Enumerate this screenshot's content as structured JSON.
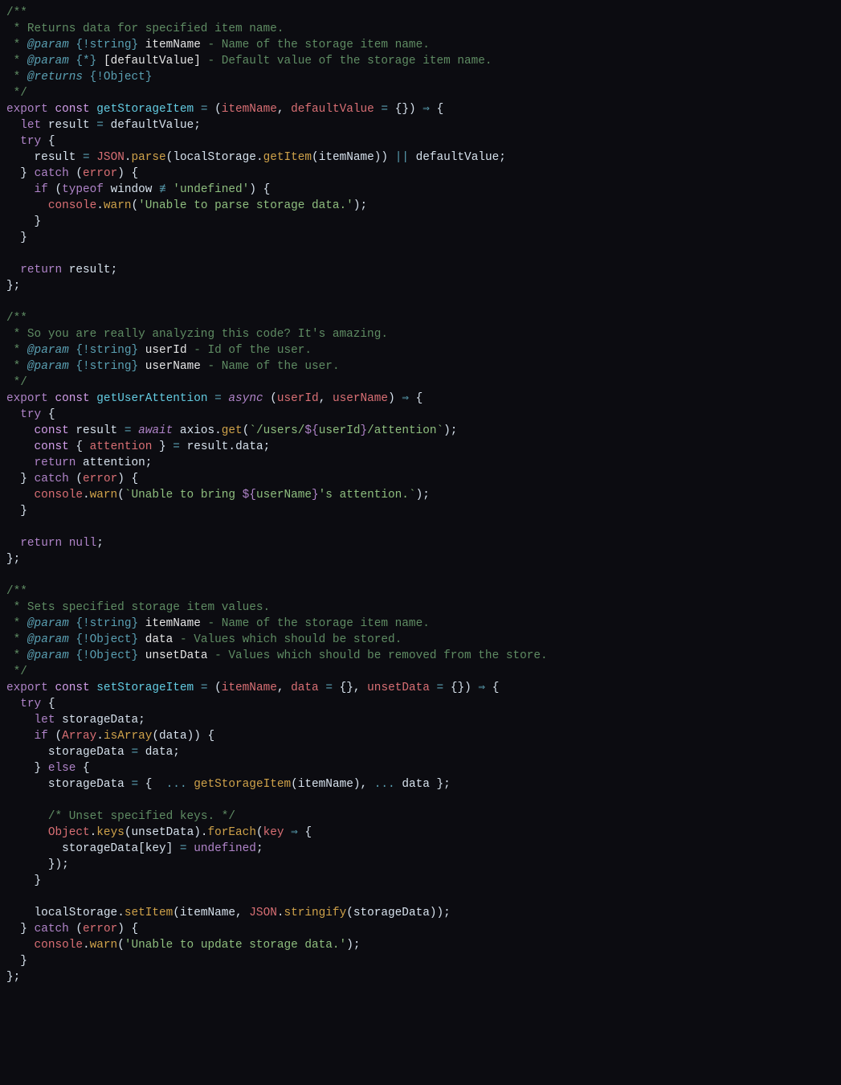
{
  "doc1": {
    "open": "/**",
    "l1": " * Returns data for specified item name.",
    "l2a": " * ",
    "l2tag": "@param",
    "l2sp": " ",
    "l2typ": "{!string}",
    "l2sp2": " ",
    "l2var": "itemName",
    "l2rest": " - Name of the storage item name.",
    "l3a": " * ",
    "l3tag": "@param",
    "l3sp": " ",
    "l3typ": "{*}",
    "l3sp2": " ",
    "l3var": "[defaultValue]",
    "l3rest": " - Default value of the storage item name.",
    "l4a": " * ",
    "l4tag": "@returns",
    "l4sp": " ",
    "l4typ": "{!Object}",
    "close": " */"
  },
  "f1": {
    "export": "export",
    "const": "const",
    "name": "getStorageItem",
    "eq": " = ",
    "args_open": "(",
    "arg1": "itemName",
    "comma": ", ",
    "arg2": "defaultValue",
    "def_eq": " = ",
    "def": "{}",
    "args_close": ")",
    "arrow": " ⇒ ",
    "brace": "{",
    "let": "let",
    "res": "result",
    "eq2": " = ",
    "dval": "defaultValue",
    "semi": ";",
    "try": "try",
    "try_open": " {",
    "res2": "result",
    "eq3": " = ",
    "json": "JSON",
    "dot": ".",
    "parse": "parse",
    "p1": "(",
    "ls": "localStorage",
    "dot2": ".",
    "get": "getItem",
    "p2": "(",
    "itm": "itemName",
    "p3": "))",
    "or": " || ",
    "dval2": "defaultValue",
    "semi2": ";",
    "catch": "} catch",
    "err_open": " (",
    "err": "error",
    "err_close": ") {",
    "if": "if",
    "if_open": " (",
    "typeof": "typeof",
    "win": " window ",
    "neq": "≢",
    "undef": " 'undefined'",
    "if_close": ") {",
    "cons": "console",
    "dot3": ".",
    "warn": "warn",
    "wmsg_open": "(",
    "wmsg": "'Unable to parse storage data.'",
    "wmsg_close": ");",
    "close_if": "}",
    "close_catch": "}",
    "return": "return",
    "retval": " result",
    "semi3": ";",
    "close_fn": "};"
  },
  "doc2": {
    "open": "/**",
    "l1": " * So you are really analyzing this code? It's amazing.",
    "l2a": " * ",
    "l2tag": "@param",
    "l2sp": " ",
    "l2typ": "{!string}",
    "l2sp2": " ",
    "l2var": "userId",
    "l2rest": " - Id of the user.",
    "l3a": " * ",
    "l3tag": "@param",
    "l3sp": " ",
    "l3typ": "{!string}",
    "l3sp2": " ",
    "l3var": "userName",
    "l3rest": " - Name of the user.",
    "close": " */"
  },
  "f2": {
    "export": "export",
    "const": "const",
    "name": "getUserAttention",
    "eq": " = ",
    "async": "async",
    "args_open": " (",
    "arg1": "userId",
    "comma": ", ",
    "arg2": "userName",
    "args_close": ")",
    "arrow": " ⇒ ",
    "brace": "{",
    "try": "try",
    "try_open": " {",
    "const2": "const",
    "res": " result",
    "eq2": " = ",
    "await": "await",
    "axios": " axios",
    "dot": ".",
    "get": "get",
    "p1": "(",
    "tpl_open": "`",
    "tpl1": "/users/",
    "exp_open": "${",
    "exp_var": "userId",
    "exp_close": "}",
    "tpl2": "/attention",
    "tpl_close": "`",
    "p2": ");",
    "const3": "const",
    "destr_open": " { ",
    "att": "attention",
    "destr_close": " }",
    "eq3": " = ",
    "resd": "result",
    "dot2": ".",
    "data": "data",
    "semi": ";",
    "return1": "return",
    "att2": " attention",
    "semi2": ";",
    "catch": "} catch",
    "err_open": " (",
    "err": "error",
    "err_close": ") {",
    "cons": "console",
    "dot3": ".",
    "warn": "warn",
    "w_open": "(",
    "t_open": "`",
    "t1": "Unable to bring ",
    "e_open": "${",
    "e_var": "userName",
    "e_close": "}",
    "t2": "'s attention.",
    "t_close": "`",
    "w_close": ");",
    "close_catch": "}",
    "return2": "return",
    "null": " null",
    "semi3": ";",
    "close_fn": "};"
  },
  "doc3": {
    "open": "/**",
    "l1": " * Sets specified storage item values.",
    "l2a": " * ",
    "l2tag": "@param",
    "l2sp": " ",
    "l2typ": "{!string}",
    "l2sp2": " ",
    "l2var": "itemName",
    "l2rest": " - Name of the storage item name.",
    "l3a": " * ",
    "l3tag": "@param",
    "l3sp": " ",
    "l3typ": "{!Object}",
    "l3sp2": " ",
    "l3var": "data",
    "l3rest": " - Values which should be stored.",
    "l4a": " * ",
    "l4tag": "@param",
    "l4sp": " ",
    "l4typ": "{!Object}",
    "l4sp2": " ",
    "l4var": "unsetData",
    "l4rest": " - Values which should be removed from the store.",
    "close": " */"
  },
  "f3": {
    "export": "export",
    "const": "const",
    "name": "setStorageItem",
    "eq": " = ",
    "args_open": "(",
    "arg1": "itemName",
    "c1": ", ",
    "arg2": "data",
    "d1": " = ",
    "d1v": "{}",
    "c2": ", ",
    "arg3": "unsetData",
    "d2": " = ",
    "d2v": "{}",
    "args_close": ")",
    "arrow": " ⇒ ",
    "brace": "{",
    "try": "try",
    "try_open": " {",
    "let": "let",
    "sd": " storageData",
    "semi0": ";",
    "if": "if",
    "if_open": " (",
    "Array": "Array",
    "dotA": ".",
    "isArray": "isArray",
    "p1": "(",
    "data2": "data",
    "p2": "))",
    "if_close": " {",
    "sd2": "storageData",
    "eq2": " = ",
    "data3": "data",
    "semi1": ";",
    "else": "} else {",
    "sd3": "storageData",
    "eq3": " = ",
    "obj_open": "{ ",
    "spread1": " ... ",
    "gsi": "getStorageItem",
    "p3": "(",
    "item2": "itemName",
    "p4": "),",
    "spread2": " ... ",
    "data4": "data",
    "obj_close": " };",
    "unset_comment": "/* Unset specified keys. */",
    "Object": "Object",
    "dotO": ".",
    "keys": "keys",
    "p5": "(",
    "ud": "unsetData",
    "p6": ").",
    "forEach": "forEach",
    "p7": "(",
    "key": "key",
    "arrow2": " ⇒ ",
    "brace2": "{",
    "sd4": "storageData",
    "idx_open": "[",
    "key2": "key",
    "idx_close": "]",
    "eq4": " = ",
    "undef": "undefined",
    "semi2": ";",
    "fe_close": "});",
    "else_close": "}",
    "ls": "localStorage",
    "dotL": ".",
    "setItem": "setItem",
    "p8": "(",
    "item3": "itemName",
    "c3": ", ",
    "json": "JSON",
    "dotJ": ".",
    "stringify": "stringify",
    "p9": "(",
    "sd5": "storageData",
    "p10": "));",
    "catch": "} catch",
    "err_open": " (",
    "err": "error",
    "err_close": ") {",
    "cons": "console",
    "dotC": ".",
    "warn": "warn",
    "w_open": "(",
    "wmsg": "'Unable to update storage data.'",
    "w_close": ");",
    "close_catch": "}",
    "close_fn": "};"
  }
}
